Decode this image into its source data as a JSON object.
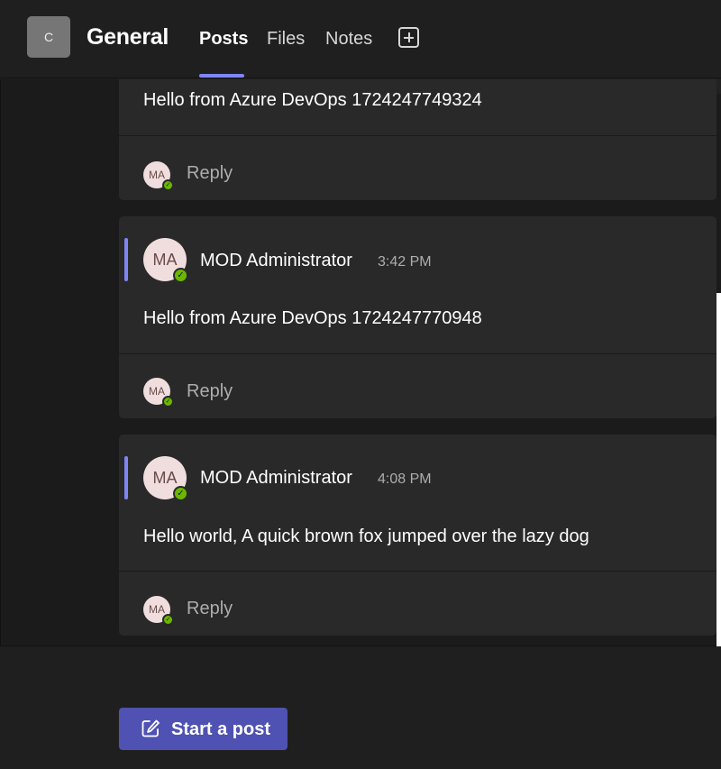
{
  "header": {
    "team_initial": "C",
    "channel_name": "General",
    "tabs": [
      {
        "label": "Posts",
        "active": true
      },
      {
        "label": "Files",
        "active": false
      },
      {
        "label": "Notes",
        "active": false
      }
    ],
    "add_tab_icon": "plus-box-icon"
  },
  "posts": [
    {
      "author": "",
      "time": "",
      "body": "Hello from Azure DevOps 1724247749324",
      "reply_avatar": "MA",
      "reply_label": "Reply"
    },
    {
      "author": "MOD Administrator",
      "avatar": "MA",
      "time": "3:42 PM",
      "body": "Hello from Azure DevOps 1724247770948",
      "reply_avatar": "MA",
      "reply_label": "Reply"
    },
    {
      "author": "MOD Administrator",
      "avatar": "MA",
      "time": "4:08 PM",
      "body": "Hello world, A quick brown fox jumped over the lazy dog",
      "reply_avatar": "MA",
      "reply_label": "Reply"
    }
  ],
  "composer": {
    "start_post_label": "Start a post",
    "icon": "compose-icon"
  },
  "colors": {
    "accent": "#7f85f5",
    "button": "#4f52b2",
    "presence": "#6bb700"
  }
}
